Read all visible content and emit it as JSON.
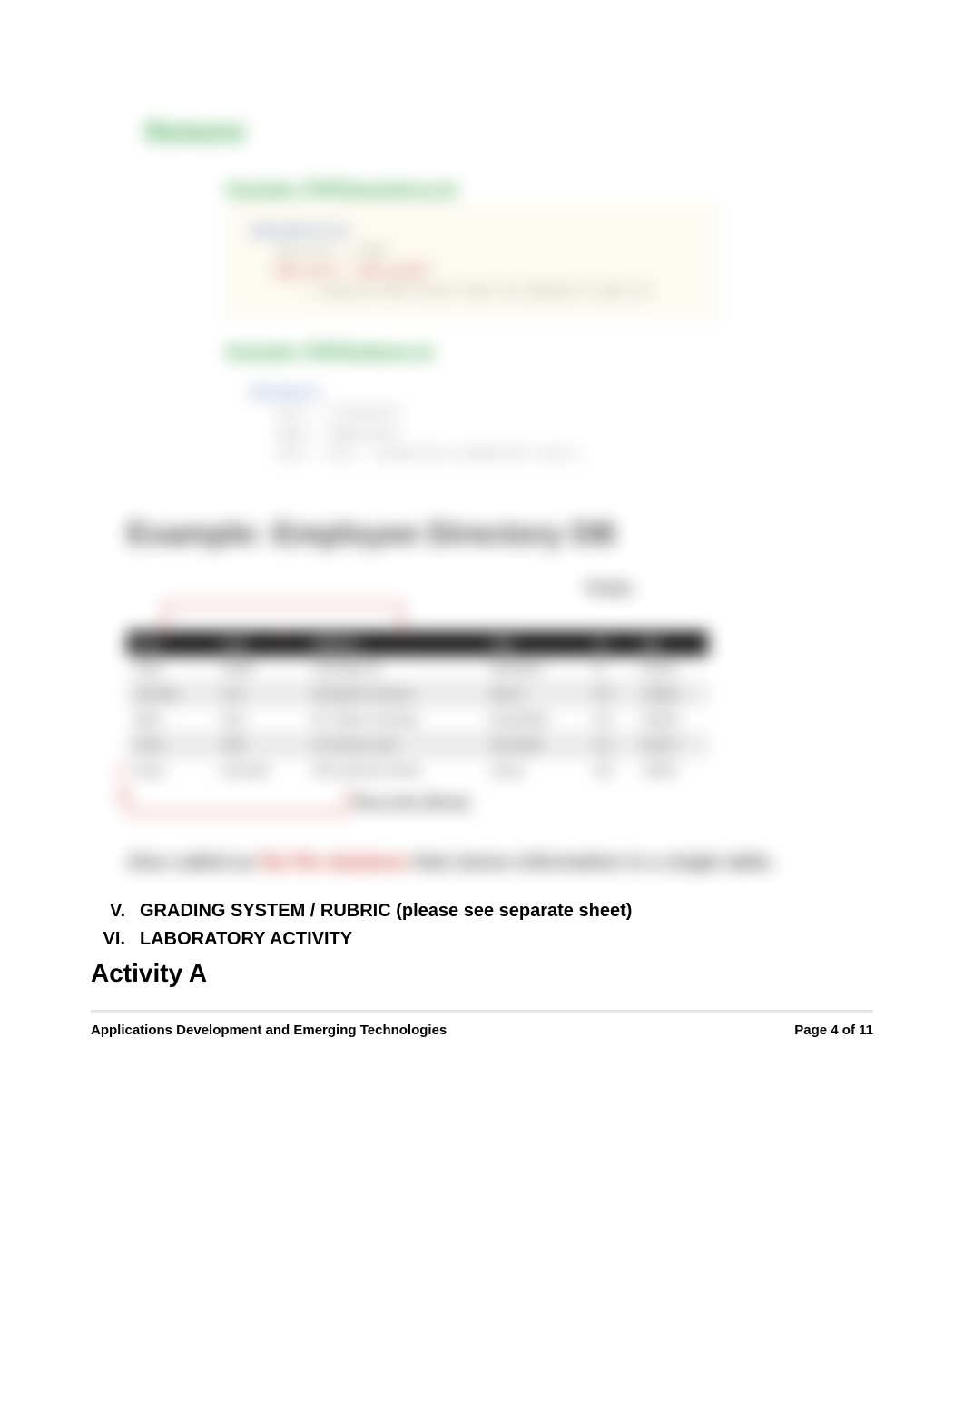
{
  "section_heading": "Resource",
  "code1": {
    "title": "Example: PHPDependency.ini",
    "l1a": "[Dependencies]",
    "l2a": "php_ext1 = \"pdo\"",
    "l3a": "php_ext2 = \"pdo_mysql\"",
    "l4a": "; required PDO drivers must be enabled in php.ini"
  },
  "code2": {
    "title": "Example: PHPDatabase.ini",
    "l1": "[Database]",
    "l2": "host = \"localhost\"",
    "l3": "name = \"employees\"",
    "l4": "user = root       ; connection credentials line 1"
  },
  "example_heading": "Example: Employee Directory DB",
  "fields_label": "Fields",
  "records_label": "Records (Row)",
  "table": {
    "headers": [
      "First",
      "Last",
      "Address",
      "City",
      "St",
      "Zip"
    ],
    "rows": [
      [
        "Jane",
        "Smith",
        "100 Main St",
        "Rockford",
        "IL",
        "61101"
      ],
      [
        "Jennifer",
        "Lee",
        "28 Barker Terrace",
        "Bronx",
        "NY",
        "10460"
      ],
      [
        "Mike",
        "Doe",
        "517 Main St Street",
        "Brookfield",
        "WI",
        "53005"
      ],
      [
        "Chris",
        "Hall",
        "11 Penny Lane",
        "Rockville",
        "AL",
        "35127"
      ],
      [
        "Dean",
        "Kenneth",
        "230 Garrison Road",
        "Dover",
        "DE",
        "19901"
      ]
    ]
  },
  "note_prefix": "Also called as ",
  "note_redtext": "flat file database",
  "note_suffix": " that stores information in a single table.",
  "roman5_num": "V.",
  "roman5_text": "GRADING SYSTEM / RUBRIC (please see separate sheet)",
  "roman6_num": "VI.",
  "roman6_text": "LABORATORY ACTIVITY",
  "activity_heading": "Activity A",
  "footer_left": "Applications Development and Emerging Technologies",
  "footer_right": "Page 4 of 11"
}
